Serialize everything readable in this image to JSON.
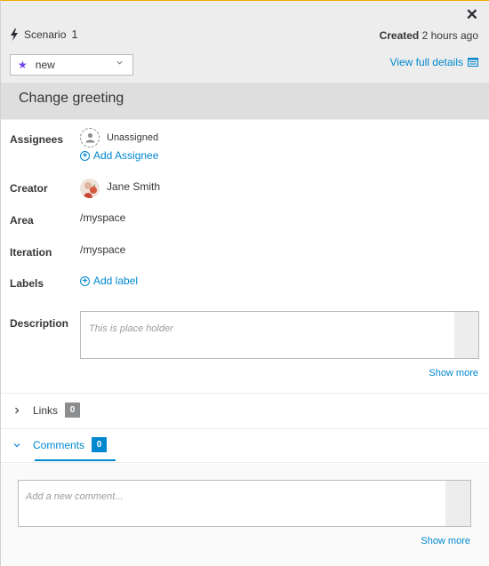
{
  "header": {
    "close_glyph": "✕",
    "type_label": "Scenario",
    "item_number": "1",
    "created_label": "Created",
    "created_time": "2 hours ago",
    "state_value": "new",
    "view_details_label": "View full details",
    "title": "Change greeting"
  },
  "fields": {
    "assignees_label": "Assignees",
    "unassigned_text": "Unassigned",
    "add_assignee_label": "Add Assignee",
    "creator_label": "Creator",
    "creator_name": "Jane Smith",
    "area_label": "Area",
    "area_value": "/myspace",
    "iteration_label": "Iteration",
    "iteration_value": "/myspace",
    "labels_label": "Labels",
    "add_label_text": "Add label",
    "description_label": "Description",
    "description_placeholder": "This is place holder",
    "show_more": "Show more"
  },
  "links": {
    "label": "Links",
    "count": "0"
  },
  "comments": {
    "label": "Comments",
    "count": "0",
    "placeholder": "Add a new comment...",
    "show_more": "Show more"
  },
  "colors": {
    "accent": "#0088ce",
    "state_star": "#703fec",
    "top_border": "#f0ab00"
  },
  "icons": [
    "close-icon",
    "bolt-icon",
    "star-icon",
    "chevron-down-icon",
    "details-icon",
    "user-icon",
    "plus-circle-icon",
    "chevron-right-icon"
  ]
}
